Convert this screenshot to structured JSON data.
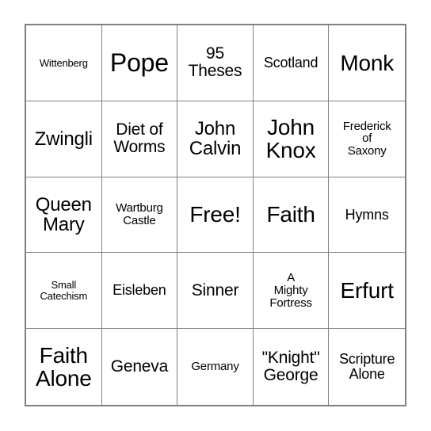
{
  "card": {
    "type": "bingo-card",
    "columns": 5,
    "rows": 5,
    "border_color": "#808080",
    "background_color": "#ffffff",
    "text_color": "#000000",
    "free_space_index": 12,
    "cells": [
      {
        "text": "Wittenberg",
        "size": "fs-xs"
      },
      {
        "text": "Pope",
        "size": "fs-xxl"
      },
      {
        "text": "95\nTheses",
        "size": "fs-ml"
      },
      {
        "text": "Scotland",
        "size": "fs-m"
      },
      {
        "text": "Monk",
        "size": "fs-xl"
      },
      {
        "text": "Zwingli",
        "size": "fs-l"
      },
      {
        "text": "Diet of\nWorms",
        "size": "fs-ml"
      },
      {
        "text": "John\nCalvin",
        "size": "fs-l"
      },
      {
        "text": "John\nKnox",
        "size": "fs-xl"
      },
      {
        "text": "Frederick\nof\nSaxony",
        "size": "fs-s"
      },
      {
        "text": "Queen\nMary",
        "size": "fs-l"
      },
      {
        "text": "Wartburg\nCastle",
        "size": "fs-s"
      },
      {
        "text": "Free!",
        "size": "fs-xl"
      },
      {
        "text": "Faith",
        "size": "fs-xl"
      },
      {
        "text": "Hymns",
        "size": "fs-m"
      },
      {
        "text": "Small\nCatechism",
        "size": "fs-xs"
      },
      {
        "text": "Eisleben",
        "size": "fs-m"
      },
      {
        "text": "Sinner",
        "size": "fs-ml"
      },
      {
        "text": "A\nMighty\nFortress",
        "size": "fs-s"
      },
      {
        "text": "Erfurt",
        "size": "fs-xl"
      },
      {
        "text": "Faith\nAlone",
        "size": "fs-xl"
      },
      {
        "text": "Geneva",
        "size": "fs-ml"
      },
      {
        "text": "Germany",
        "size": "fs-s"
      },
      {
        "text": "\"Knight\"\nGeorge",
        "size": "fs-ml"
      },
      {
        "text": "Scripture\nAlone",
        "size": "fs-m"
      }
    ]
  }
}
